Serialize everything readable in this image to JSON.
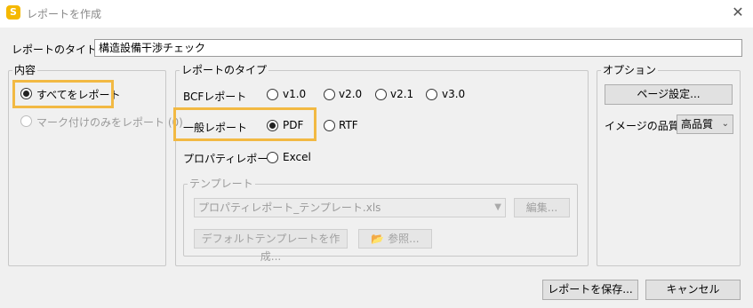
{
  "window": {
    "title": "レポートを作成",
    "icon_letter": "S",
    "close_glyph": "✕"
  },
  "report_title": {
    "label": "レポートのタイトル",
    "value": "構造設備干渉チェック"
  },
  "content": {
    "legend": "内容",
    "all_label": "すべてをレポート",
    "marked_label": "マーク付けのみをレポート (0)"
  },
  "report_type": {
    "legend": "レポートのタイプ",
    "bcf_label": "BCFレポート",
    "bcf_options": [
      "v1.0",
      "v2.0",
      "v2.1",
      "v3.0"
    ],
    "general_label": "一般レポート",
    "pdf_label": "PDF",
    "rtf_label": "RTF",
    "property_label": "プロパティレポート",
    "excel_label": "Excel"
  },
  "template": {
    "legend": "テンプレート",
    "selected": "プロパティレポート_テンプレート.xls",
    "edit_label": "編集...",
    "create_default_label": "デフォルトテンプレートを作成...",
    "browse_label": "参照..."
  },
  "options": {
    "legend": "オプション",
    "page_setup_label": "ページ設定...",
    "image_quality_label": "イメージの品質",
    "image_quality_value": "高品質"
  },
  "footer": {
    "save_label": "レポートを保存...",
    "cancel_label": "キャンセル"
  },
  "colors": {
    "highlight": "#f2b943",
    "background": "#f0f0f0"
  }
}
